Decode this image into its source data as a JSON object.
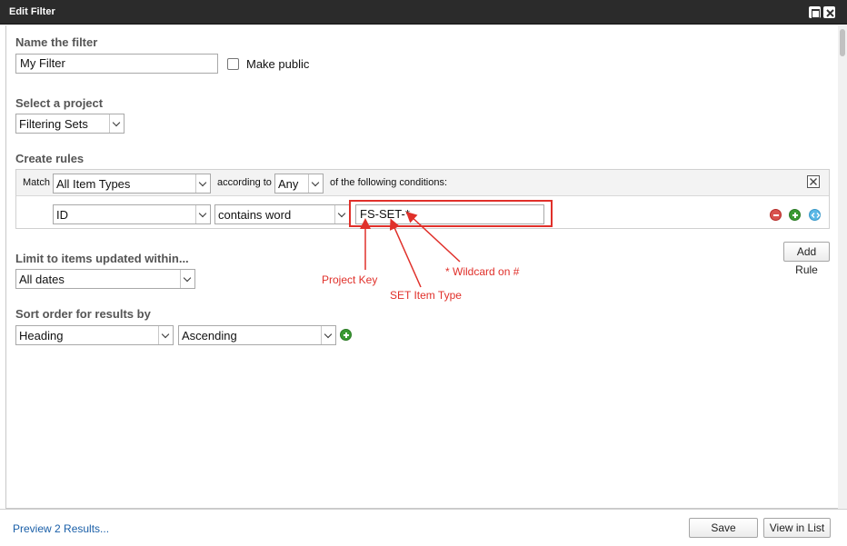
{
  "window": {
    "title": "Edit Filter"
  },
  "name_section": {
    "label": "Name the filter",
    "value": "My Filter",
    "make_public_label": "Make public",
    "make_public_checked": false
  },
  "project_section": {
    "label": "Select a project",
    "selected": "Filtering Sets"
  },
  "rules_section": {
    "label": "Create rules",
    "match_label": "Match",
    "item_types": "All Item Types",
    "according_label": "according to",
    "any_value": "Any",
    "conditions_label": "of the following conditions:",
    "rule": {
      "field": "ID",
      "operator": "contains word",
      "value": "FS-SET-*"
    },
    "add_rule_label": "Add Rule"
  },
  "limit_section": {
    "label": "Limit to items updated within...",
    "selected": "All dates"
  },
  "sort_section": {
    "label": "Sort order for results by",
    "field": "Heading",
    "order": "Ascending"
  },
  "annotations": {
    "project_key": "Project Key",
    "set_item_type": "SET Item Type",
    "wildcard": "* Wildcard on #",
    "color": "#e0302a"
  },
  "footer": {
    "preview_link": "Preview 2 Results...",
    "save_label": "Save",
    "view_in_list_label": "View in List"
  }
}
